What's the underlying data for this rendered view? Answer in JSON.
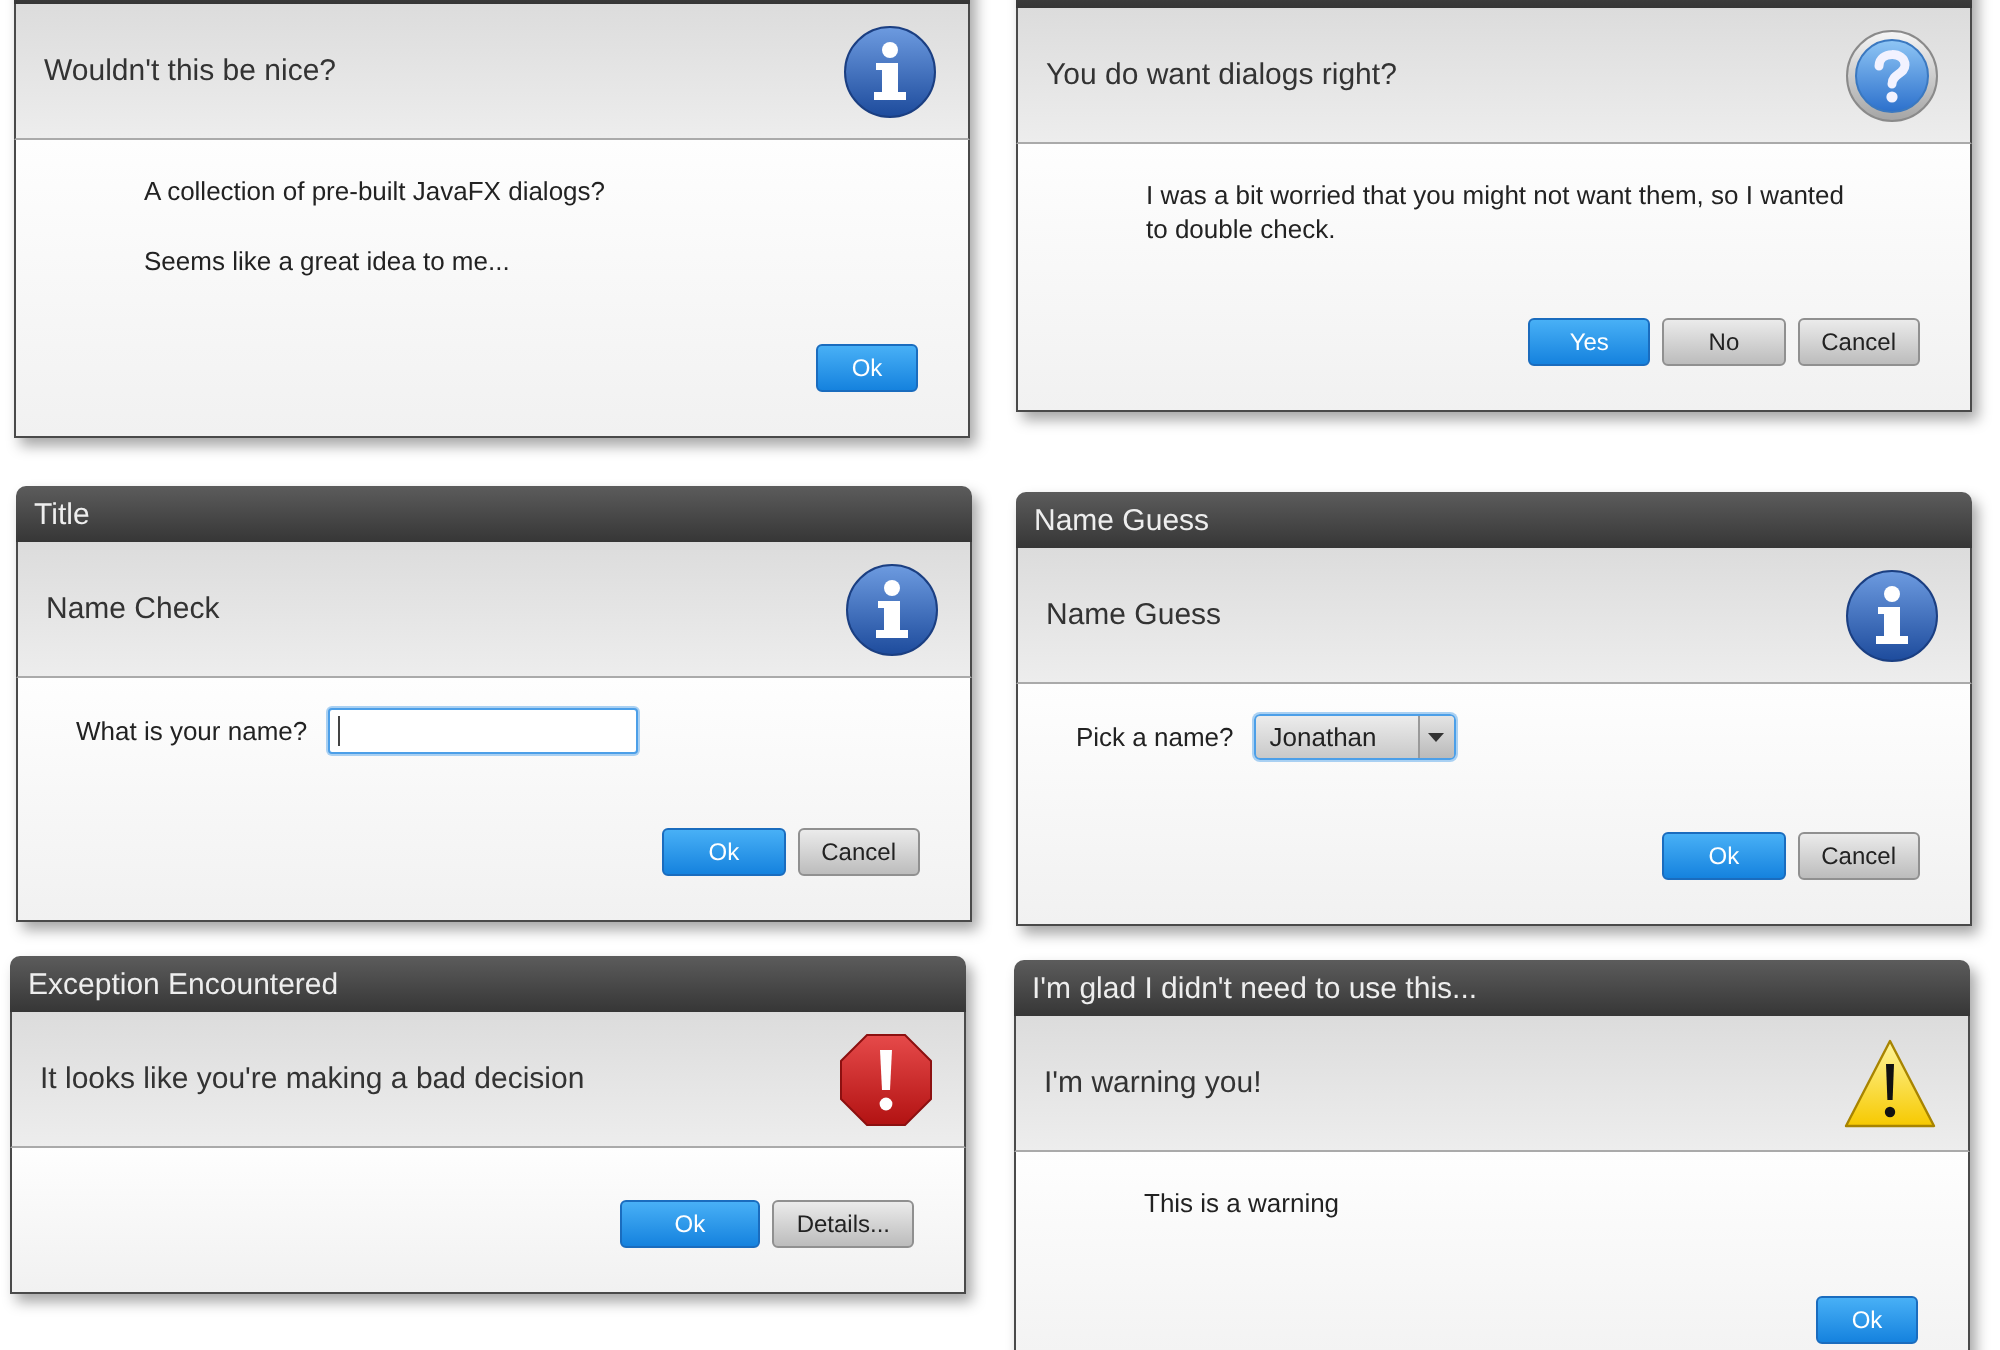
{
  "dialogs": [
    {
      "masthead": "Wouldn't this be nice?",
      "kind": "information",
      "message": [
        "A collection of pre-built JavaFX dialogs?",
        "Seems like a great idea to me..."
      ],
      "buttons": [
        {
          "label": "Ok",
          "default": true
        }
      ]
    },
    {
      "masthead": "You do want dialogs right?",
      "kind": "confirmation",
      "message": [
        "I was a bit worried that you might not want them, so I wanted to double check."
      ],
      "buttons": [
        {
          "label": "Yes",
          "default": true
        },
        {
          "label": "No",
          "default": false
        },
        {
          "label": "Cancel",
          "default": false
        }
      ]
    },
    {
      "title": "Title",
      "masthead": "Name Check",
      "kind": "information",
      "field": {
        "kind": "text",
        "label": "What is your name?",
        "focused": true
      },
      "buttons": [
        {
          "label": "Ok",
          "default": true
        },
        {
          "label": "Cancel",
          "default": false
        }
      ]
    },
    {
      "title": "Name Guess",
      "masthead": "Name Guess",
      "kind": "information",
      "field": {
        "kind": "choice",
        "label": "Pick a name?",
        "value": "Jonathan",
        "focused": true
      },
      "buttons": [
        {
          "label": "Ok",
          "default": true
        },
        {
          "label": "Cancel",
          "default": false
        }
      ]
    },
    {
      "title": "Exception Encountered",
      "masthead": "It looks like you're making a bad decision",
      "kind": "error",
      "buttons": [
        {
          "label": "Ok",
          "default": true
        },
        {
          "label": "Details...",
          "default": false
        }
      ]
    },
    {
      "title": "I'm glad I didn't need to use this...",
      "masthead": "I'm warning you!",
      "kind": "warning",
      "message": [
        "This is a warning"
      ],
      "buttons": [
        {
          "label": "Ok",
          "default": true
        }
      ]
    }
  ]
}
